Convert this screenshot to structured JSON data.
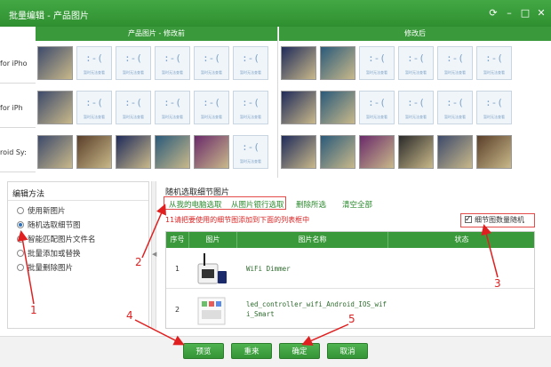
{
  "window": {
    "title": "批量编辑 - 产品图片",
    "controls": [
      "refresh-icon",
      "minimize-icon",
      "maximize-icon",
      "close-icon"
    ]
  },
  "grid": {
    "header_before": "产品图片 - 修改前",
    "header_after": "修改后",
    "placeholder_face": ":-(",
    "placeholder_caption": "暂时无法查看",
    "rows": [
      {
        "label": "for iPho"
      },
      {
        "label": "for iPh"
      },
      {
        "label": "roid Sy:"
      }
    ]
  },
  "left_panel": {
    "title": "编辑方法",
    "options": [
      {
        "label": "使用新图片",
        "selected": false
      },
      {
        "label": "随机选取细节图",
        "selected": true
      },
      {
        "label": "智能匹配图片文件名",
        "selected": false
      },
      {
        "label": "批量添加或替换",
        "selected": false
      },
      {
        "label": "批量删除图片",
        "selected": false
      }
    ]
  },
  "right_panel": {
    "title": "随机选取细节图片",
    "links": {
      "from_computer": "从我的电脑选取",
      "from_bank": "从图片银行选取",
      "delete_selected": "删除所选",
      "clear_all": "清空全部"
    },
    "tip": "11请把要使用的细节图添加到下面的列表框中",
    "random_count_label": "细节图数量随机",
    "random_count_checked": true,
    "table": {
      "headers": [
        "序号",
        "图片",
        "图片名称",
        "状态"
      ],
      "rows": [
        {
          "index": "1",
          "name": "WiFi Dimmer",
          "status": ""
        },
        {
          "index": "2",
          "name": "led_controller_wifi_Android_IOS_wifi_Smart",
          "status": ""
        }
      ]
    }
  },
  "buttons": {
    "preview": "预览",
    "reset": "重来",
    "confirm": "确定",
    "cancel": "取消"
  },
  "annotations": [
    "1",
    "2",
    "3",
    "4",
    "5"
  ],
  "colors": {
    "brand_green": "#3a9a3b",
    "annotation_red": "#e02020",
    "link_green": "#2a8a2c"
  }
}
